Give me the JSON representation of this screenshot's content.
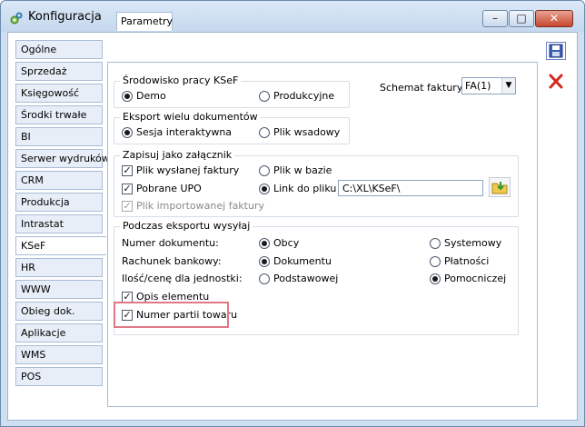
{
  "window": {
    "title": "Konfiguracja",
    "buttons": {
      "minimize": "–",
      "maximize": "□",
      "close": "✕"
    }
  },
  "sidebar": {
    "items": [
      {
        "label": "Ogólne"
      },
      {
        "label": "Sprzedaż"
      },
      {
        "label": "Księgowość"
      },
      {
        "label": "Środki trwałe"
      },
      {
        "label": "BI"
      },
      {
        "label": "Serwer wydruków"
      },
      {
        "label": "CRM"
      },
      {
        "label": "Produkcja"
      },
      {
        "label": "Intrastat"
      },
      {
        "label": "KSeF"
      },
      {
        "label": "HR"
      },
      {
        "label": "WWW"
      },
      {
        "label": "Obieg dok."
      },
      {
        "label": "Aplikacje"
      },
      {
        "label": "WMS"
      },
      {
        "label": "POS"
      }
    ],
    "active_index": 9
  },
  "tabs": [
    {
      "label": "Parametry"
    }
  ],
  "environment": {
    "title": "Środowisko pracy KSeF",
    "options": [
      "Demo",
      "Produkcyjne"
    ],
    "selected": "Demo"
  },
  "invoice_schema": {
    "label": "Schemat faktury:",
    "value": "FA(1)"
  },
  "export_multi": {
    "title": "Eksport wielu dokumentów",
    "options": [
      "Sesja interaktywna",
      "Plik wsadowy"
    ],
    "selected": "Sesja interaktywna"
  },
  "save_attachment": {
    "title": "Zapisuj jako załącznik",
    "checkboxes": [
      {
        "label": "Plik wysłanej faktury",
        "checked": true,
        "disabled": false
      },
      {
        "label": "Pobrane UPO",
        "checked": true,
        "disabled": false
      },
      {
        "label": "Plik importowanej faktury",
        "checked": true,
        "disabled": true
      }
    ],
    "radios": [
      "Plik w bazie",
      "Link do pliku"
    ],
    "selected": "Link do pliku",
    "path": "C:\\XL\\KSeF\\"
  },
  "export_sending": {
    "title": "Podczas eksportu wysyłaj",
    "rows": [
      {
        "label": "Numer dokumentu:",
        "options": [
          "Obcy",
          "Systemowy"
        ],
        "selected": "Obcy"
      },
      {
        "label": "Rachunek bankowy:",
        "options": [
          "Dokumentu",
          "Płatności"
        ],
        "selected": "Dokumentu"
      },
      {
        "label": "Ilość/cenę dla jednostki:",
        "options": [
          "Podstawowej",
          "Pomocniczej"
        ],
        "selected": "Pomocniczej"
      }
    ],
    "checkboxes": [
      {
        "label": "Opis elementu",
        "checked": true
      },
      {
        "label": "Numer partii towaru",
        "checked": true
      }
    ]
  },
  "colors": {
    "highlight": "#e07888",
    "titlebar": "#c5d8ee"
  }
}
